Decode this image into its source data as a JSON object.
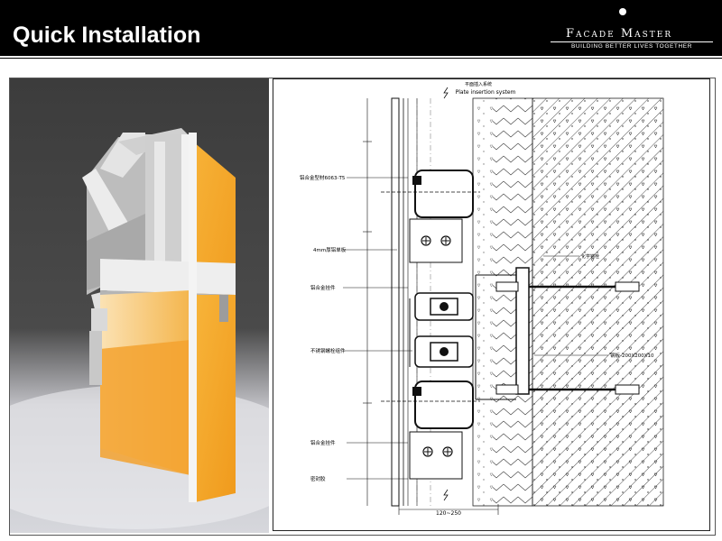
{
  "header": {
    "title": "Quick Installation",
    "brand": "Facade Master",
    "tagline": "BUILDING BETTER LIVES TOGETHER"
  },
  "drawing": {
    "title_cn": "平面插入系统",
    "title_en": "Plate insertion system",
    "labels": {
      "aluminum_profile": "铝合金型材6063-T5",
      "panel_4mm": "4mm厚铝单板",
      "connector": "铝合金挂件",
      "bolt_assembly": "不锈钢螺栓组件",
      "steel_plate_spec": "钢板-200X200X10",
      "anchor": "化学锚栓",
      "seal": "密封胶",
      "dimension_bottom": "120~250"
    }
  },
  "colors": {
    "header_bg": "#000000",
    "panel_orange": "#f5a92a",
    "profile_gray": "#d8d8d8",
    "render_bg": "#3a3a3a"
  }
}
